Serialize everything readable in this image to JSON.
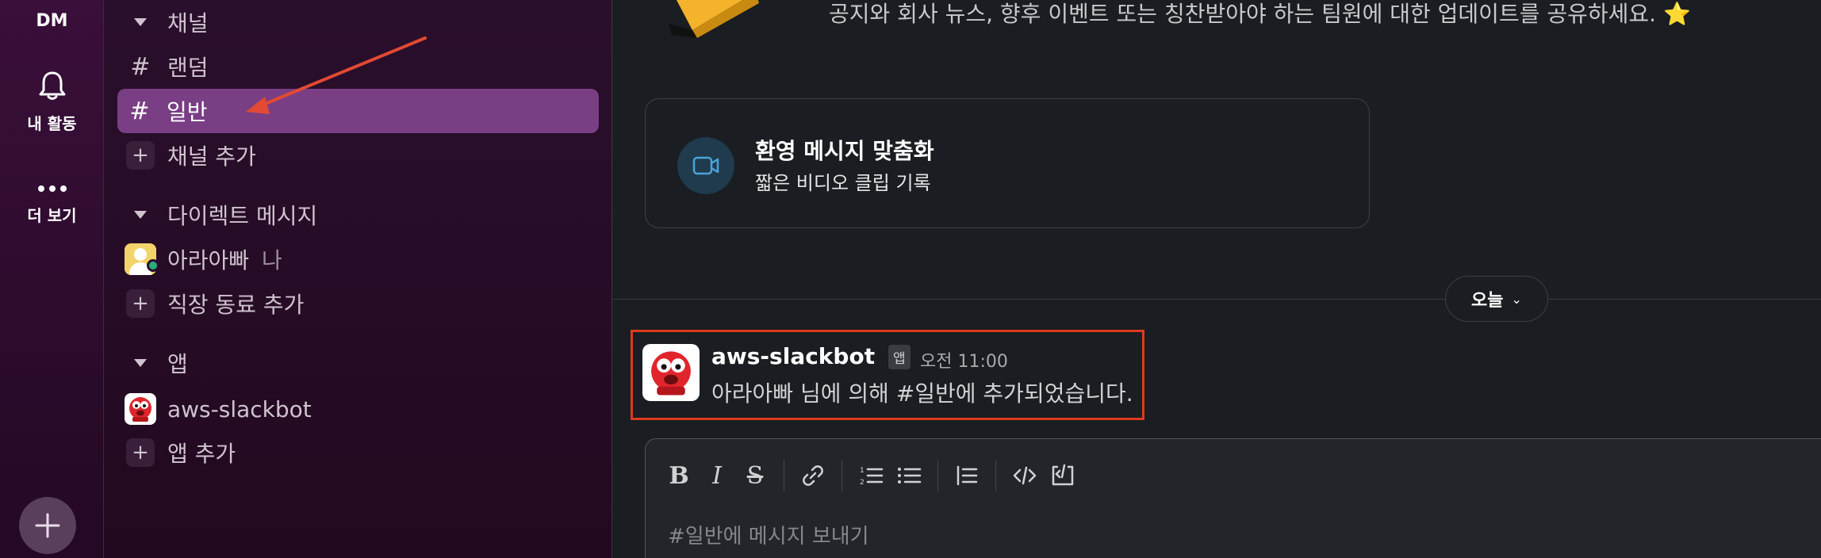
{
  "rail": {
    "dm_label": "DM",
    "activity_label": "내 활동",
    "more_label": "더 보기",
    "add_icon": "plus-icon"
  },
  "sidebar": {
    "channels_header": "채널",
    "channels": [
      {
        "label": "랜덤",
        "icon": "hash-icon"
      },
      {
        "label": "일반",
        "icon": "hash-icon",
        "active": true
      }
    ],
    "add_channel": "채널 추가",
    "dm_header": "다이렉트 메시지",
    "dm_user": "아라아빠",
    "dm_user_suffix": "나",
    "add_coworker": "직장 동료 추가",
    "apps_header": "앱",
    "app_item": "aws-slackbot",
    "add_app": "앱 추가"
  },
  "main": {
    "banner_text": "공지와 회사 뉴스, 향후 이벤트 또는 칭찬받아야 하는 팀원에 대한 업데이트를 공유하세요. ⭐",
    "welcome_card": {
      "title": "환영 메시지 맞춤화",
      "subtitle": "짧은 비디오 클립 기록"
    },
    "date_pill": "오늘",
    "message": {
      "author": "aws-slackbot",
      "badge": "앱",
      "time": "오전 11:00",
      "text": "아라아빠 님에 의해 #일반에 추가되었습니다."
    },
    "composer": {
      "placeholder": "#일반에 메시지 보내기"
    }
  },
  "colors": {
    "active_item": "#7a3e85",
    "highlight_box": "#e0391f",
    "annotation_arrow": "#e24a33"
  }
}
